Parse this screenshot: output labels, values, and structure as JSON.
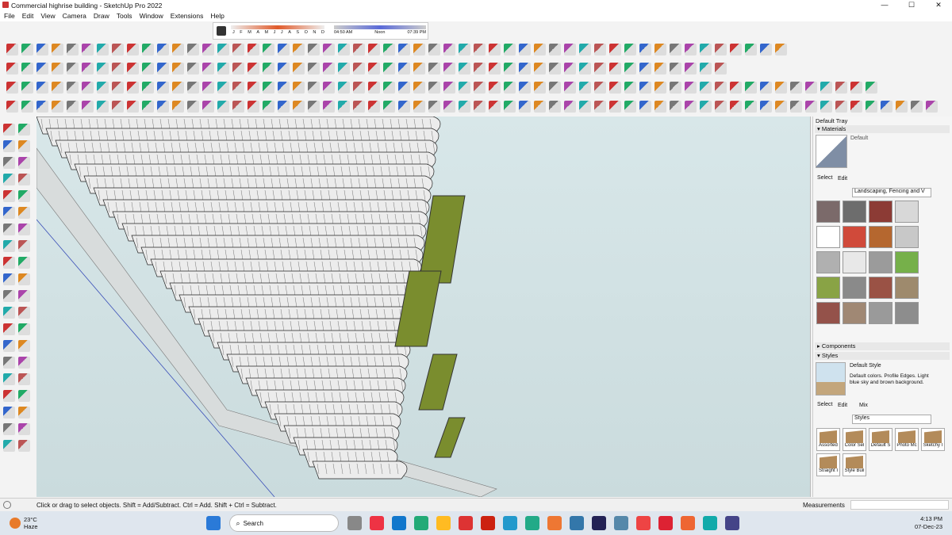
{
  "window": {
    "title": "Commercial highrise building - SketchUp Pro 2022",
    "min": "—",
    "max": "☐",
    "close": "✕"
  },
  "menu": [
    "File",
    "Edit",
    "View",
    "Camera",
    "Draw",
    "Tools",
    "Window",
    "Extensions",
    "Help"
  ],
  "shadows": {
    "months": [
      "J",
      "F",
      "M",
      "A",
      "M",
      "J",
      "J",
      "A",
      "S",
      "O",
      "N",
      "D"
    ],
    "time_start": "04:50 AM",
    "time_mid": "Noon",
    "time_end": "07:39 PM"
  },
  "tray": {
    "title": "Default Tray",
    "materials": {
      "label": "Materials",
      "current": "Default",
      "select": "Select",
      "edit": "Edit",
      "library": "Landscaping, Fencing and V"
    },
    "components": {
      "label": "Components"
    },
    "styles": {
      "label": "Styles",
      "current": "Default Style",
      "description": "Default colors. Profile Edges. Light blue sky and brown background.",
      "select": "Select",
      "edit": "Edit",
      "mix": "Mix",
      "library": "Styles",
      "items": [
        "Assorted",
        "Color Sel",
        "Default S",
        "Photo Mc",
        "Sketchy I",
        "Straight I",
        "Style Buil"
      ]
    }
  },
  "swatch_colors": [
    "#7b6a6a",
    "#6d6d6d",
    "#8c3b35",
    "#d8d8d8",
    "#ffffff",
    "#d04a3a",
    "#b5672f",
    "#c8c8c8",
    "#b0b0b0",
    "#e8e8e8",
    "#9b9b9b",
    "#76b04a",
    "#89a345",
    "#8a8a8a",
    "#9a5245",
    "#9e8a6d",
    "#94524a",
    "#a08874",
    "#9a9a9a",
    "#8d8d8d"
  ],
  "status": {
    "hint": "Click or drag to select objects. Shift = Add/Subtract. Ctrl = Add. Shift + Ctrl = Subtract.",
    "measurements": "Measurements"
  },
  "taskbar": {
    "temp": "23°C",
    "weather": "Haze",
    "search": "Search",
    "time": "4:13 PM",
    "date": "07-Dec-23"
  }
}
